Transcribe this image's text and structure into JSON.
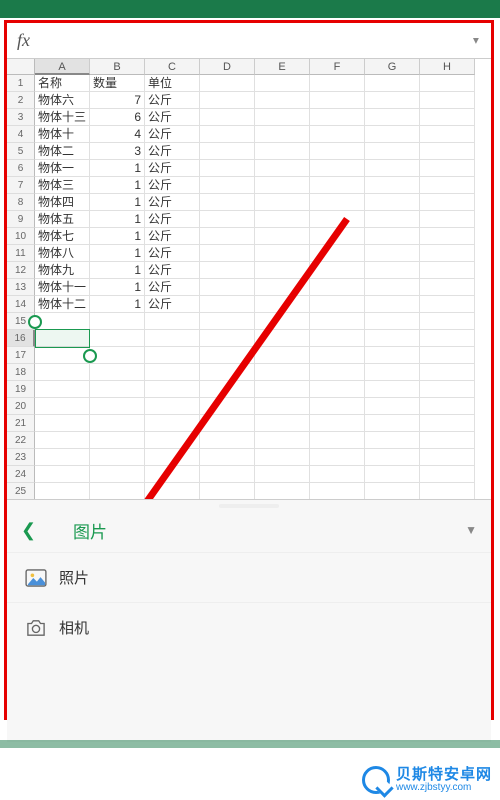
{
  "formula_bar": {
    "fx": "fx"
  },
  "columns": [
    "A",
    "B",
    "C",
    "D",
    "E",
    "F",
    "G",
    "H"
  ],
  "active_column_index": 0,
  "row_count": 26,
  "active_rows": [
    16
  ],
  "selection": {
    "row_start": 15,
    "row_end": 17,
    "col": "A"
  },
  "table": {
    "headers": {
      "name": "名称",
      "qty": "数量",
      "unit": "单位"
    },
    "rows": [
      {
        "name": "物体六",
        "qty": 7,
        "unit": "公斤"
      },
      {
        "name": "物体十三",
        "qty": 6,
        "unit": "公斤"
      },
      {
        "name": "物体十",
        "qty": 4,
        "unit": "公斤"
      },
      {
        "name": "物体二",
        "qty": 3,
        "unit": "公斤"
      },
      {
        "name": "物体一",
        "qty": 1,
        "unit": "公斤"
      },
      {
        "name": "物体三",
        "qty": 1,
        "unit": "公斤"
      },
      {
        "name": "物体四",
        "qty": 1,
        "unit": "公斤"
      },
      {
        "name": "物体五",
        "qty": 1,
        "unit": "公斤"
      },
      {
        "name": "物体七",
        "qty": 1,
        "unit": "公斤"
      },
      {
        "name": "物体八",
        "qty": 1,
        "unit": "公斤"
      },
      {
        "name": "物体九",
        "qty": 1,
        "unit": "公斤"
      },
      {
        "name": "物体十一",
        "qty": 1,
        "unit": "公斤"
      },
      {
        "name": "物体十二",
        "qty": 1,
        "unit": "公斤"
      }
    ]
  },
  "panel": {
    "title": "图片",
    "items": [
      {
        "icon": "photo",
        "label": "照片"
      },
      {
        "icon": "camera",
        "label": "相机"
      }
    ]
  },
  "watermark": {
    "cn": "贝斯特安卓网",
    "url": "www.zjbstyy.com"
  }
}
